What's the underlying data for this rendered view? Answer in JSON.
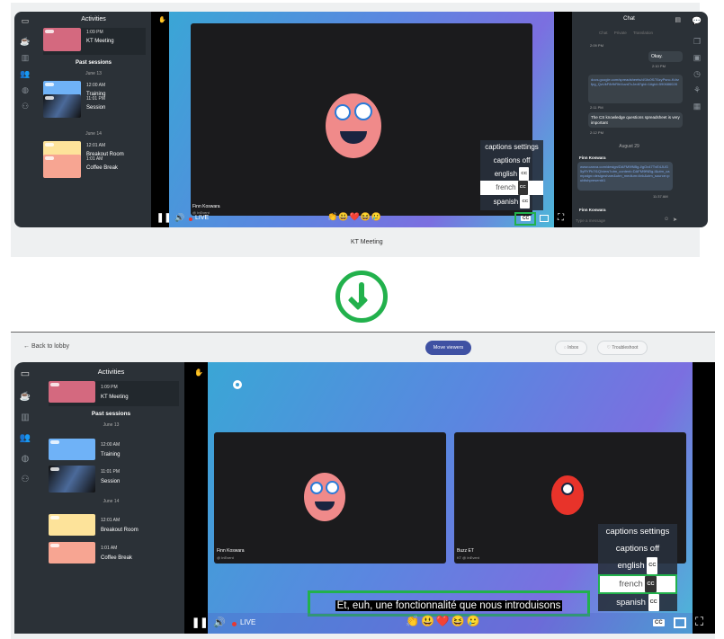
{
  "top": {
    "meeting_title": "KT Meeting",
    "sidebar": {
      "header": "Activities",
      "current": {
        "time": "1:09 PM",
        "name": "KT Meeting",
        "color": "#d4697f"
      },
      "past_header": "Past sessions",
      "groups": [
        {
          "date": "June 13",
          "sessions": [
            {
              "time": "12:00 AM",
              "name": "Training",
              "color": "#6fb2f7"
            },
            {
              "time": "11:01 PM",
              "name": "Session",
              "color": "#1f2a3c"
            }
          ]
        },
        {
          "date": "June 14",
          "sessions": [
            {
              "time": "12:01 AM",
              "name": "Breakout Room",
              "color": "#fde39a"
            },
            {
              "time": "1:01 AM",
              "name": "Coffee Break",
              "color": "#f7a592"
            }
          ]
        }
      ]
    },
    "speaker": {
      "name": "Finn Koswara",
      "org": "@ InEvent"
    },
    "live_label": "LIVE",
    "captions_menu": [
      "captions settings",
      "captions off",
      "english",
      "french",
      "spanish"
    ],
    "selected_caption": "french",
    "cc_label": "CC",
    "chat": {
      "title": "Chat",
      "tabs": [
        "Chat",
        "Private",
        "Translation"
      ],
      "messages": [
        {
          "time": "2:09 PM"
        },
        {
          "text": "Okay.",
          "time": "2:10 PM",
          "own": true
        },
        {
          "text": "docs.google.com/spreadsheets/d/1fo0f1T6zyPsnc-Kdrzfpg_QzUkF8rfhRhI4uvd7cJedt?gid=1#gid=590686028",
          "time": "2:11 PM",
          "link": true
        },
        {
          "text": "The CS knowledge questions spreadsheet is very important",
          "time": "2:12 PM"
        }
      ],
      "date_divider": "August 29",
      "sender": "Finn Koswara",
      "link_message": "www.canva.com/design/DAFM9fNBg-I/gOx47TvE4JUG5yRYPk7t1Q/view?utm_content=DAFM9fNBg-I&utm_campaign=designshare&utm_medium=link&utm_source=publishpresent#1",
      "link_time": "11:37 AM",
      "sender2": "Finn Koswara",
      "placeholder": "Type a message"
    }
  },
  "bottom": {
    "back_label": "Back to lobby",
    "move_viewers": "Move viewers",
    "inbox": "Inbox",
    "troubleshoot": "Troubleshoot",
    "speakers": [
      {
        "name": "Finn Koswara",
        "org": "@ InEvent"
      },
      {
        "name": "Buzz ET",
        "org": "KT @ InEvent"
      }
    ],
    "caption_text": "Et, euh, une fonctionnalité que nous introduisons",
    "live_label": "LIVE"
  },
  "reactions": [
    "👏",
    "😃",
    "❤️",
    "😆",
    "🥲"
  ],
  "colors": {
    "accent": "#3f51a3",
    "highlight": "#22b14c",
    "live": "#e53935"
  }
}
